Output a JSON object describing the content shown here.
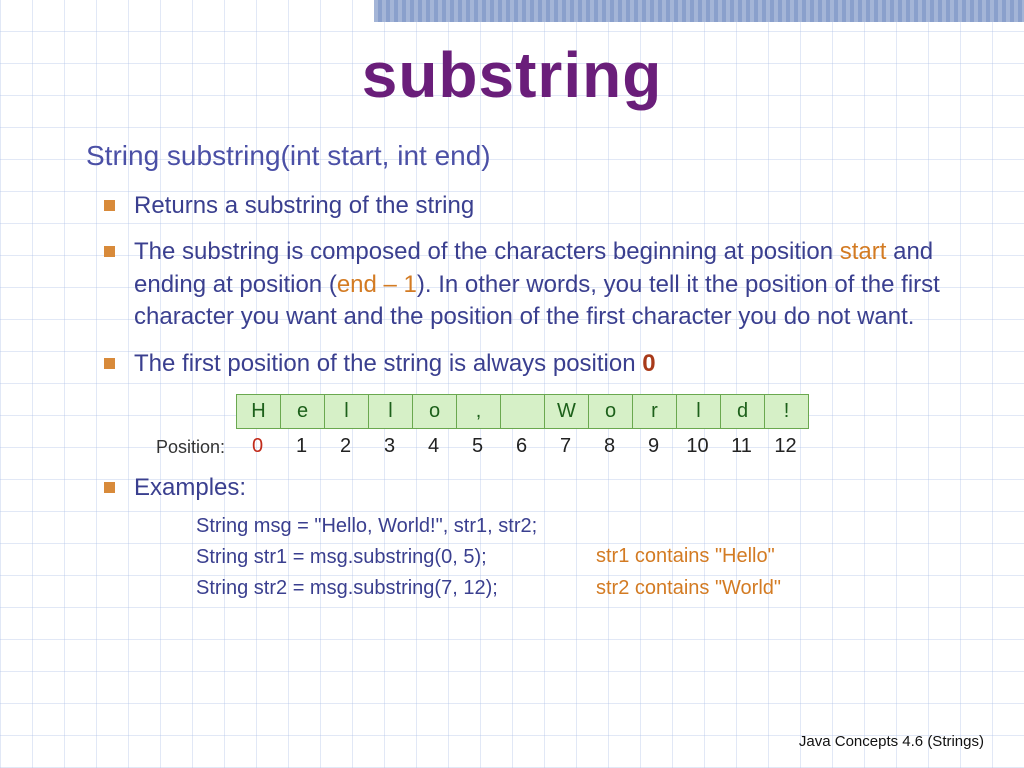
{
  "title": "substring",
  "signature": "String substring(int start, int end)",
  "bullets": {
    "b1": "Returns a substring of the string",
    "b2a": "The substring is composed of the characters beginning at position ",
    "b2_start": "start",
    "b2b": " and ending at position (",
    "b2_end": "end – 1",
    "b2c": "). In other words, you tell it the position of the first character you want and the position of the first character you do not want.",
    "b3a": "The first position of the string is always position ",
    "b3_zero": "0",
    "examples_label": "Examples:"
  },
  "chart_data": {
    "type": "table",
    "title": "Character positions of \"Hello, World!\"",
    "characters": [
      "H",
      "e",
      "l",
      "l",
      "o",
      ",",
      "",
      "W",
      "o",
      "r",
      "l",
      "d",
      "!"
    ],
    "positions": [
      0,
      1,
      2,
      3,
      4,
      5,
      6,
      7,
      8,
      9,
      10,
      11,
      12
    ],
    "position_label": "Position:"
  },
  "code": {
    "l1": "String msg = \"Hello, World!\", str1, str2;",
    "l2": "String str1 = msg.substring(0, 5);",
    "l3": "String str2 = msg.substring(7, 12);"
  },
  "contains": {
    "c1": "str1 contains \"Hello\"",
    "c2": "str2 contains \"World\""
  },
  "footer": "Java Concepts 4.6 (Strings)"
}
